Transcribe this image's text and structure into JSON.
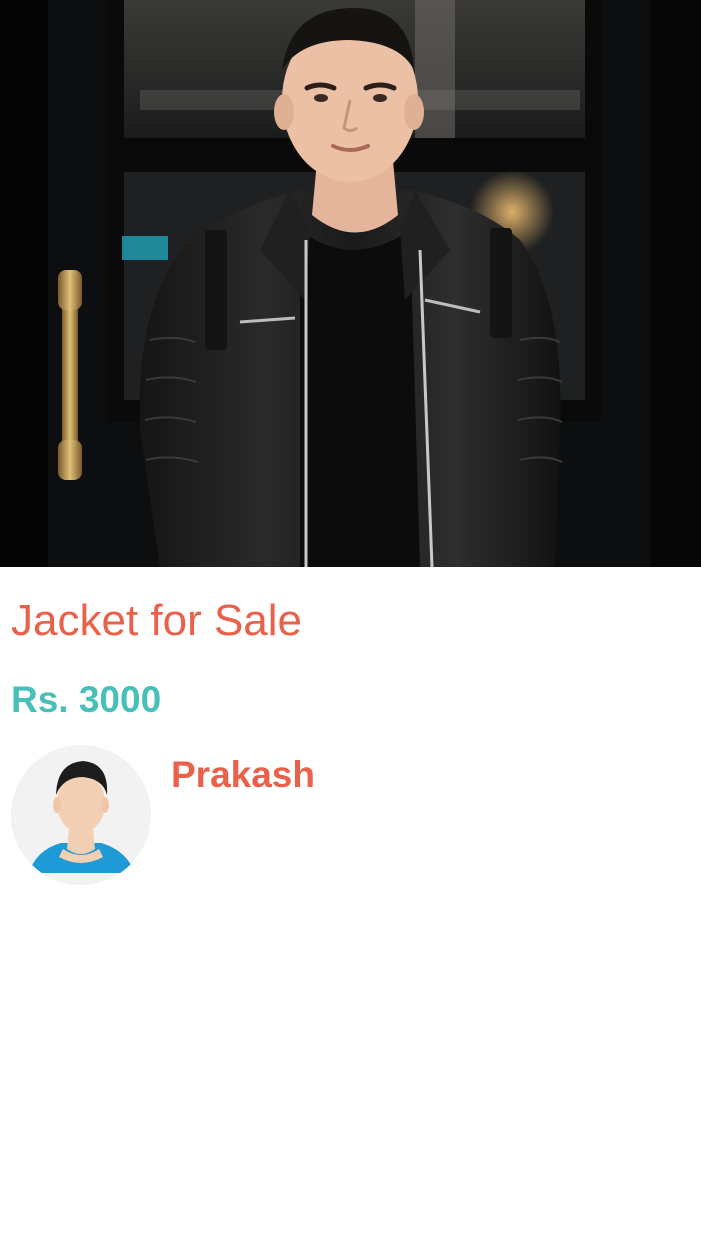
{
  "listing": {
    "image_icon": "product-photo-leather-jacket",
    "title": "Jacket for Sale",
    "price": "Rs. 3000"
  },
  "seller": {
    "avatar_icon": "default-user-avatar",
    "name": "Prakash"
  },
  "colors": {
    "title": "#e9614a",
    "price": "#48bfb8",
    "seller_name": "#e9614a"
  }
}
